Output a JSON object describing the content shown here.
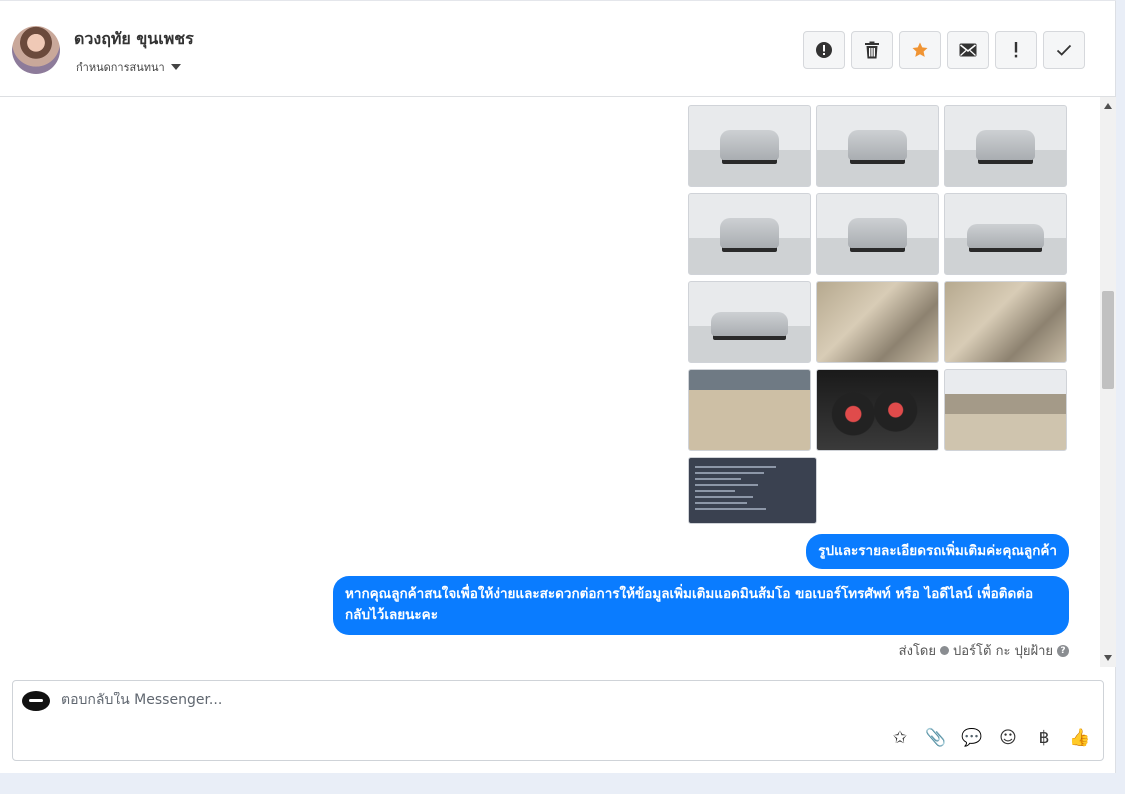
{
  "header": {
    "contact_name": "ดวงฤทัย ขุนเพชร",
    "conversation_menu": "กำหนดการสนทนา",
    "actions": [
      {
        "name": "report-spam-button",
        "icon": "alert-circle-icon",
        "color": "#333333"
      },
      {
        "name": "delete-button",
        "icon": "trash-icon",
        "color": "#333333"
      },
      {
        "name": "star-button",
        "icon": "star-icon",
        "color": "#f09433"
      },
      {
        "name": "mark-unread-button",
        "icon": "envelope-icon",
        "color": "#333333"
      },
      {
        "name": "important-button",
        "icon": "exclamation-icon",
        "color": "#333333"
      },
      {
        "name": "done-button",
        "icon": "check-icon",
        "color": "#333333"
      }
    ]
  },
  "messages": {
    "bubble_1": "รูปและรายละเอียดรถเพิ่มเติมค่ะคุณลูกค้า",
    "bubble_2": "หากคุณลูกค้าสนใจเพื่อให้ง่ายและสะดวกต่อการให้ข้อมูลเพิ่มเติมแอดมินส้มโอ ขอเบอร์โทรศัพท์ หรือ ไอดีไลน์ เพื่อติดต่อกลับไว้เลยนะคะ",
    "sent_by_label": "ส่งโดย",
    "sent_by_name": "ปอร์โต้ กะ ปุยฝ้าย"
  },
  "photos": [
    {
      "name": "photo-front",
      "kind": "car"
    },
    {
      "name": "photo-front-angle",
      "kind": "car"
    },
    {
      "name": "photo-rear-angle",
      "kind": "car"
    },
    {
      "name": "photo-rear",
      "kind": "car"
    },
    {
      "name": "photo-rear-side",
      "kind": "car"
    },
    {
      "name": "photo-side-right",
      "kind": "side"
    },
    {
      "name": "photo-side-left",
      "kind": "side"
    },
    {
      "name": "photo-gear-console",
      "kind": "int"
    },
    {
      "name": "photo-front-seats",
      "kind": "int"
    },
    {
      "name": "photo-rear-seats",
      "kind": "seat"
    },
    {
      "name": "photo-gauges",
      "kind": "dash"
    },
    {
      "name": "photo-dashboard",
      "kind": "cab"
    },
    {
      "name": "photo-spec-sheet",
      "kind": "doc"
    }
  ],
  "composer": {
    "placeholder": "ตอบกลับใน Messenger...",
    "tools": [
      {
        "name": "saved-reply-icon",
        "glyph": "✩"
      },
      {
        "name": "attachment-icon",
        "glyph": "📎"
      },
      {
        "name": "chat-bubbles-icon",
        "glyph": "💬"
      },
      {
        "name": "emoji-icon",
        "glyph": "☺"
      },
      {
        "name": "baht-payment-icon",
        "glyph": "฿"
      },
      {
        "name": "like-icon",
        "glyph": "👍"
      }
    ]
  },
  "colors": {
    "bubble": "#0a7cff",
    "star": "#f09433"
  }
}
